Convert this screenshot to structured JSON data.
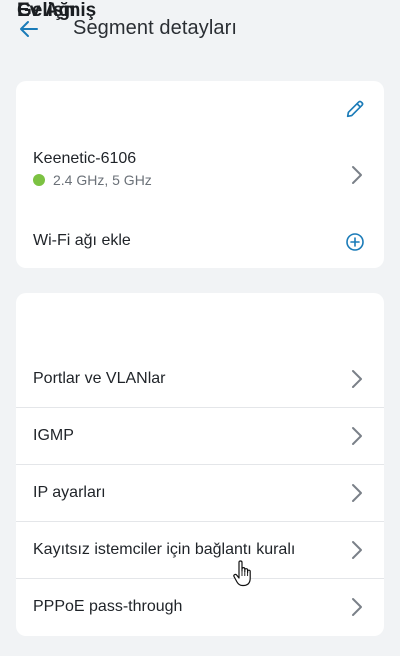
{
  "header": {
    "title": "Segment detayları",
    "back_icon": "arrow-left-icon"
  },
  "network_card": {
    "title": "Ev Ağı",
    "edit_icon": "pencil-icon",
    "network": {
      "name": "Keenetic-6106",
      "bands": "2.4 GHz, 5 GHz",
      "status_color": "#7cc242"
    },
    "add_wifi_label": "Wi-Fi ağı ekle",
    "add_icon": "plus-circle-icon"
  },
  "advanced_card": {
    "title": "Gelişmiş",
    "items": [
      {
        "label": "Portlar ve VLANlar"
      },
      {
        "label": "IGMP"
      },
      {
        "label": "IP ayarları"
      },
      {
        "label": "Kayıtsız istemciler için bağlantı kuralı"
      },
      {
        "label": "PPPoE pass-through"
      }
    ]
  },
  "colors": {
    "accent": "#1a7bb8",
    "background": "#f1f3f5",
    "card": "#ffffff",
    "status_green": "#7cc242"
  }
}
